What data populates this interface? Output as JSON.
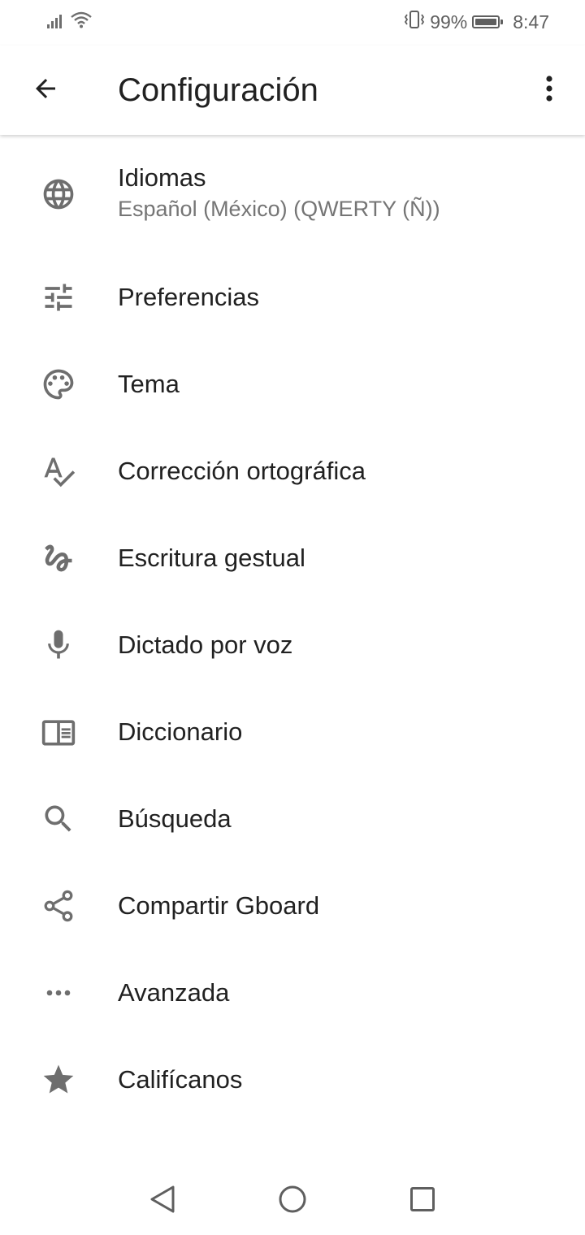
{
  "status_bar": {
    "battery_percent": "99%",
    "time": "8:47",
    "battery_level": 0.99
  },
  "app_bar": {
    "title": "Configuración",
    "back_icon": "arrow-back-icon",
    "more_icon": "more-vert-icon"
  },
  "settings": {
    "items": [
      {
        "icon": "globe-icon",
        "title": "Idiomas",
        "subtitle": "Español (México) (QWERTY (Ñ))"
      },
      {
        "icon": "tune-icon",
        "title": "Preferencias"
      },
      {
        "icon": "palette-icon",
        "title": "Tema"
      },
      {
        "icon": "spellcheck-icon",
        "title": "Corrección ortográfica"
      },
      {
        "icon": "gesture-icon",
        "title": "Escritura gestual"
      },
      {
        "icon": "mic-icon",
        "title": "Dictado por voz"
      },
      {
        "icon": "dictionary-icon",
        "title": "Diccionario"
      },
      {
        "icon": "search-icon",
        "title": "Búsqueda"
      },
      {
        "icon": "share-icon",
        "title": "Compartir Gboard"
      },
      {
        "icon": "more-horiz-icon",
        "title": "Avanzada"
      },
      {
        "icon": "star-icon",
        "title": "Califícanos"
      }
    ]
  },
  "nav_bar": {
    "back_icon": "nav-back-triangle-icon",
    "home_icon": "nav-home-circle-icon",
    "recents_icon": "nav-recents-square-icon"
  },
  "colors": {
    "icon": "#6e6e6e",
    "text_primary": "#212121",
    "text_secondary": "#757575",
    "background": "#ffffff"
  }
}
